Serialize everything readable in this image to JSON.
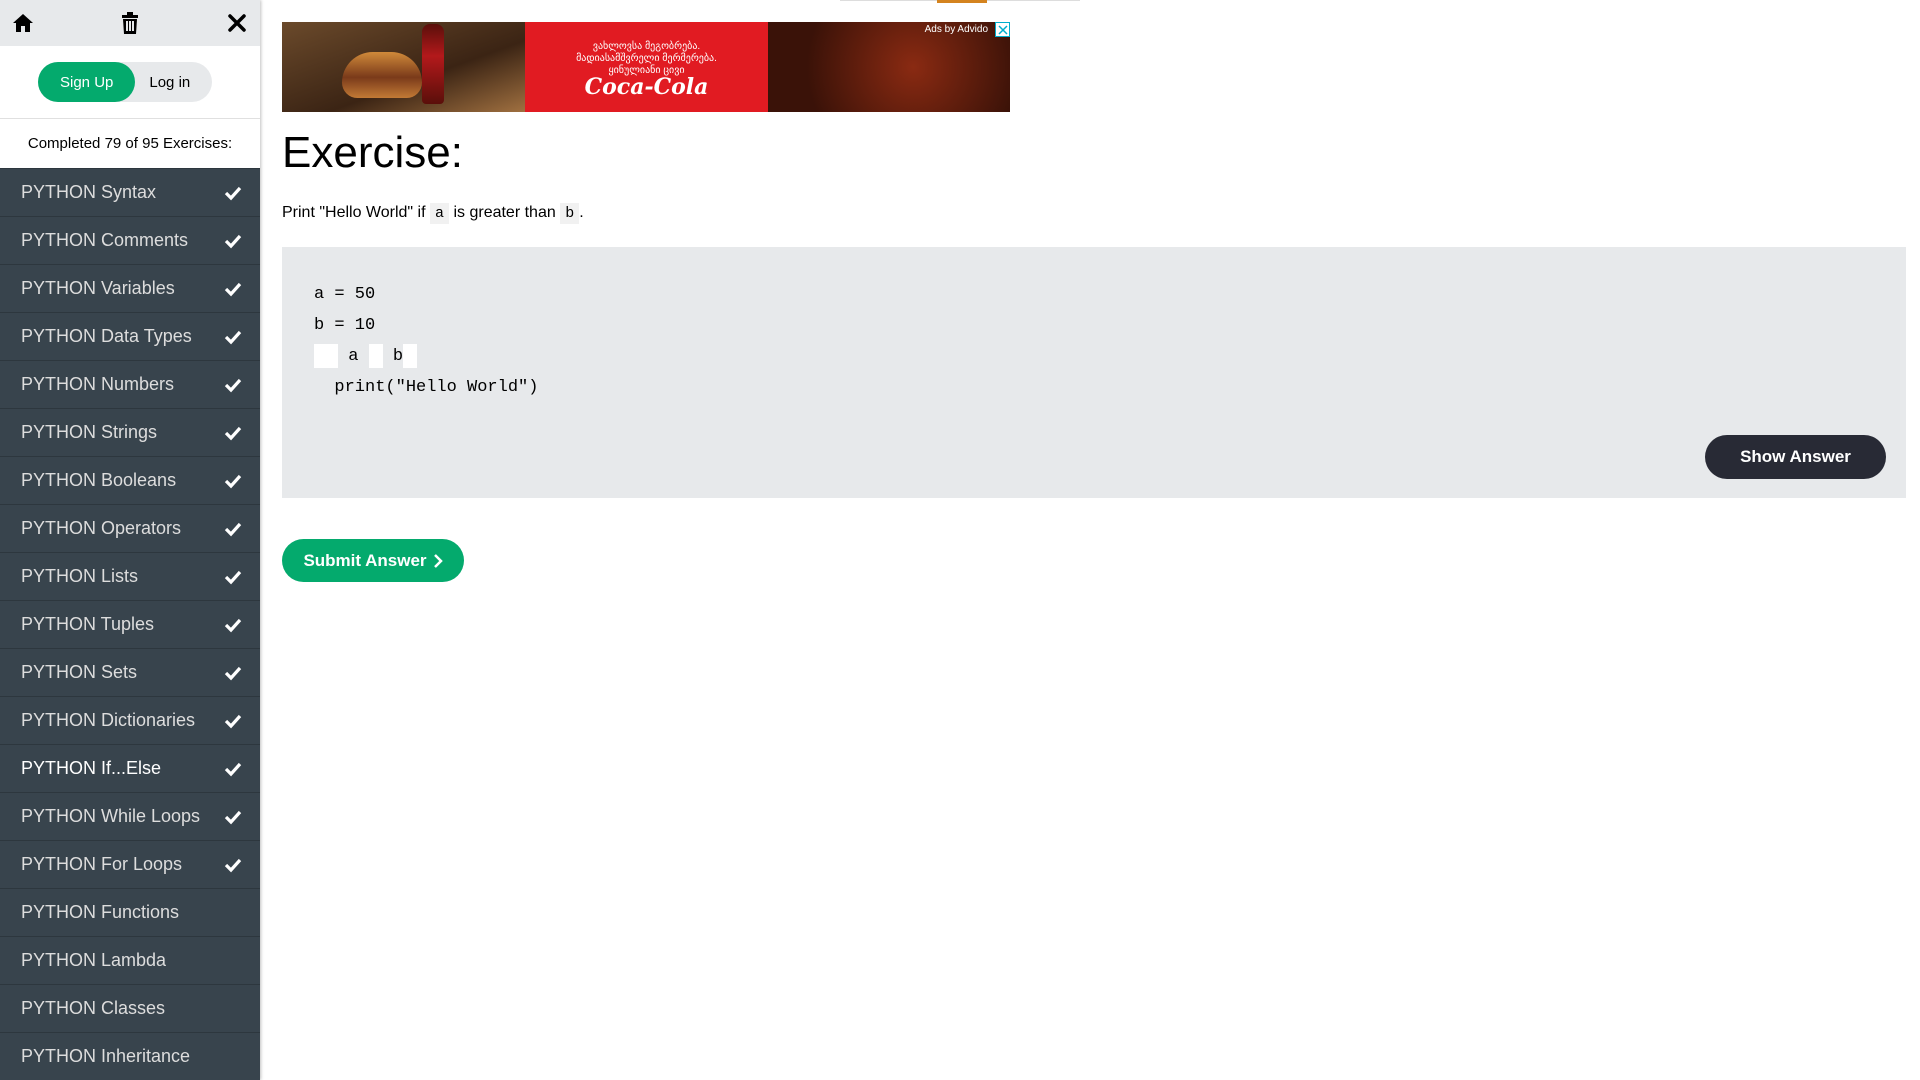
{
  "sidebar": {
    "icons": [
      "home-icon",
      "trash-icon",
      "close-icon"
    ],
    "signup_label": "Sign Up",
    "login_label": "Log in",
    "progress_text": "Completed 79 of 95 Exercises:",
    "items": [
      {
        "label": "PYTHON Syntax",
        "done": true
      },
      {
        "label": "PYTHON Comments",
        "done": true
      },
      {
        "label": "PYTHON Variables",
        "done": true
      },
      {
        "label": "PYTHON Data Types",
        "done": true
      },
      {
        "label": "PYTHON Numbers",
        "done": true
      },
      {
        "label": "PYTHON Strings",
        "done": true
      },
      {
        "label": "PYTHON Booleans",
        "done": true
      },
      {
        "label": "PYTHON Operators",
        "done": true
      },
      {
        "label": "PYTHON Lists",
        "done": true
      },
      {
        "label": "PYTHON Tuples",
        "done": true
      },
      {
        "label": "PYTHON Sets",
        "done": true
      },
      {
        "label": "PYTHON Dictionaries",
        "done": true
      },
      {
        "label": "PYTHON If...Else",
        "done": true,
        "active": true
      },
      {
        "label": "PYTHON While Loops",
        "done": true
      },
      {
        "label": "PYTHON For Loops",
        "done": true
      },
      {
        "label": "PYTHON Functions",
        "done": false
      },
      {
        "label": "PYTHON Lambda",
        "done": false
      },
      {
        "label": "PYTHON Classes",
        "done": false
      },
      {
        "label": "PYTHON Inheritance",
        "done": false
      }
    ]
  },
  "ad": {
    "label": "Ads by Advido",
    "text_line1": "ვახლოვსა მეგობრება.",
    "text_line2": "მადიასამშვრელი მერმერება.",
    "text_line3": "ყინულიანი ცივი",
    "brand": "Coca-Cola"
  },
  "exercise": {
    "title": "Exercise:",
    "desc_prefix": "Print \"Hello World\" if ",
    "var_a": "a",
    "desc_middle": " is greater than ",
    "var_b": "b",
    "desc_suffix": ".",
    "code_line1": "a = 50",
    "code_line2": "b = 10",
    "code_line3_a": "a",
    "code_line3_b": "b",
    "code_line4": "  print(\"Hello World\")",
    "show_answer_label": "Show Answer",
    "submit_label": "Submit Answer"
  },
  "colors": {
    "accent_green": "#04aa6d",
    "sidebar_dark": "#38444d",
    "code_bg": "#e7e9eb",
    "dark_button": "#282a35"
  }
}
